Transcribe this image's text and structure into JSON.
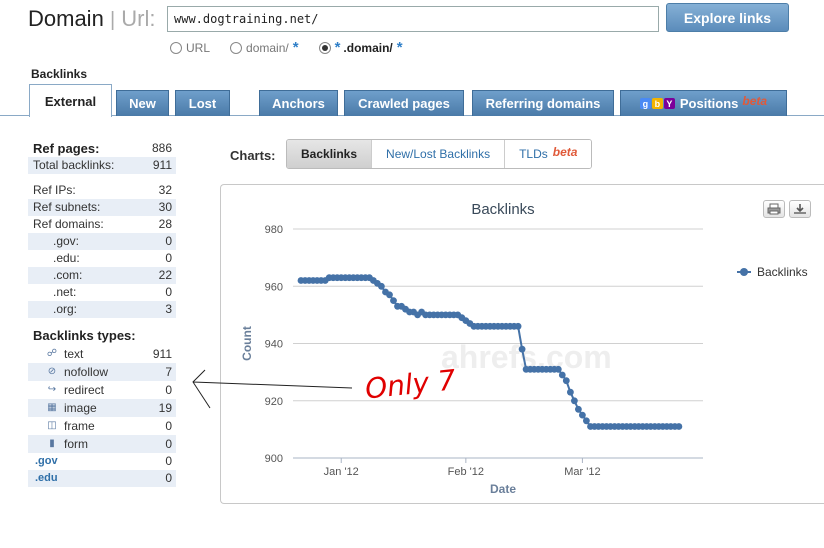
{
  "header": {
    "brand_domain": "Domain",
    "brand_sep": "|",
    "brand_url": "Url:",
    "url_value": "www.dogtraining.net/",
    "explore_label": "Explore links",
    "radio_url": "URL",
    "radio_domain": "domain/",
    "radio_star": "*",
    "radio_subdomain": ".domain/",
    "radio_subdomain_prefix": "*"
  },
  "section_title": "Backlinks",
  "tabs": {
    "external": "External",
    "new": "New",
    "lost": "Lost",
    "anchors": "Anchors",
    "crawled": "Crawled pages",
    "referring": "Referring domains",
    "positions": "Positions",
    "beta": "beta"
  },
  "stats": {
    "ref_pages": {
      "k": "Ref pages:",
      "v": "886"
    },
    "total_backlinks": {
      "k": "Total backlinks:",
      "v": "911"
    },
    "ref_ips": {
      "k": "Ref IPs:",
      "v": "32"
    },
    "ref_subnets": {
      "k": "Ref subnets:",
      "v": "30"
    },
    "ref_domains": {
      "k": "Ref domains:",
      "v": "28"
    },
    "gov": {
      "k": ".gov:",
      "v": "0"
    },
    "edu": {
      "k": ".edu:",
      "v": "0"
    },
    "com": {
      "k": ".com:",
      "v": "22"
    },
    "net": {
      "k": ".net:",
      "v": "0"
    },
    "org": {
      "k": ".org:",
      "v": "3"
    },
    "types_head": "Backlinks types:",
    "text": {
      "k": "text",
      "v": "911"
    },
    "nofollow": {
      "k": "nofollow",
      "v": "7"
    },
    "redirect": {
      "k": "redirect",
      "v": "0"
    },
    "image": {
      "k": "image",
      "v": "19"
    },
    "frame": {
      "k": "frame",
      "v": "0"
    },
    "form": {
      "k": "form",
      "v": "0"
    },
    "gov_link": {
      "k": ".gov",
      "v": "0"
    },
    "edu_link": {
      "k": ".edu",
      "v": "0"
    }
  },
  "charts": {
    "label": "Charts:",
    "tab_backlinks": "Backlinks",
    "tab_newlost": "New/Lost Backlinks",
    "tab_tlds": "TLDs",
    "beta": "beta"
  },
  "annotation": "Only 7",
  "colors": {
    "series": "#4572a7",
    "tab": "#5a8ab8",
    "beta": "#e05a3a",
    "annotation": "#e00000"
  },
  "chart_data": {
    "type": "line",
    "title": "Backlinks",
    "xlabel": "Date",
    "ylabel": "Count",
    "ylim": [
      900,
      980
    ],
    "yticks": [
      900,
      920,
      940,
      960,
      980
    ],
    "xticks": [
      {
        "date": "2012-01-01",
        "label": "Jan '12"
      },
      {
        "date": "2012-02-01",
        "label": "Feb '12"
      },
      {
        "date": "2012-03-01",
        "label": "Mar '12"
      }
    ],
    "xlim": [
      "2011-12-20",
      "2012-03-31"
    ],
    "legend": "right",
    "series": [
      {
        "name": "Backlinks",
        "points": [
          [
            "2011-12-22",
            962
          ],
          [
            "2011-12-23",
            962
          ],
          [
            "2011-12-24",
            962
          ],
          [
            "2011-12-25",
            962
          ],
          [
            "2011-12-26",
            962
          ],
          [
            "2011-12-27",
            962
          ],
          [
            "2011-12-28",
            962
          ],
          [
            "2011-12-29",
            963
          ],
          [
            "2011-12-30",
            963
          ],
          [
            "2011-12-31",
            963
          ],
          [
            "2012-01-01",
            963
          ],
          [
            "2012-01-02",
            963
          ],
          [
            "2012-01-03",
            963
          ],
          [
            "2012-01-04",
            963
          ],
          [
            "2012-01-05",
            963
          ],
          [
            "2012-01-06",
            963
          ],
          [
            "2012-01-07",
            963
          ],
          [
            "2012-01-08",
            963
          ],
          [
            "2012-01-09",
            962
          ],
          [
            "2012-01-10",
            961
          ],
          [
            "2012-01-11",
            960
          ],
          [
            "2012-01-12",
            958
          ],
          [
            "2012-01-13",
            957
          ],
          [
            "2012-01-14",
            955
          ],
          [
            "2012-01-15",
            953
          ],
          [
            "2012-01-16",
            953
          ],
          [
            "2012-01-17",
            952
          ],
          [
            "2012-01-18",
            951
          ],
          [
            "2012-01-19",
            951
          ],
          [
            "2012-01-20",
            950
          ],
          [
            "2012-01-21",
            951
          ],
          [
            "2012-01-22",
            950
          ],
          [
            "2012-01-23",
            950
          ],
          [
            "2012-01-24",
            950
          ],
          [
            "2012-01-25",
            950
          ],
          [
            "2012-01-26",
            950
          ],
          [
            "2012-01-27",
            950
          ],
          [
            "2012-01-28",
            950
          ],
          [
            "2012-01-29",
            950
          ],
          [
            "2012-01-30",
            950
          ],
          [
            "2012-01-31",
            949
          ],
          [
            "2012-02-01",
            948
          ],
          [
            "2012-02-02",
            947
          ],
          [
            "2012-02-03",
            946
          ],
          [
            "2012-02-04",
            946
          ],
          [
            "2012-02-05",
            946
          ],
          [
            "2012-02-06",
            946
          ],
          [
            "2012-02-07",
            946
          ],
          [
            "2012-02-08",
            946
          ],
          [
            "2012-02-09",
            946
          ],
          [
            "2012-02-10",
            946
          ],
          [
            "2012-02-11",
            946
          ],
          [
            "2012-02-12",
            946
          ],
          [
            "2012-02-13",
            946
          ],
          [
            "2012-02-14",
            946
          ],
          [
            "2012-02-15",
            938
          ],
          [
            "2012-02-16",
            931
          ],
          [
            "2012-02-17",
            931
          ],
          [
            "2012-02-18",
            931
          ],
          [
            "2012-02-19",
            931
          ],
          [
            "2012-02-20",
            931
          ],
          [
            "2012-02-21",
            931
          ],
          [
            "2012-02-22",
            931
          ],
          [
            "2012-02-23",
            931
          ],
          [
            "2012-02-24",
            931
          ],
          [
            "2012-02-25",
            929
          ],
          [
            "2012-02-26",
            927
          ],
          [
            "2012-02-27",
            923
          ],
          [
            "2012-02-28",
            920
          ],
          [
            "2012-02-29",
            917
          ],
          [
            "2012-03-01",
            915
          ],
          [
            "2012-03-02",
            913
          ],
          [
            "2012-03-03",
            911
          ],
          [
            "2012-03-04",
            911
          ],
          [
            "2012-03-05",
            911
          ],
          [
            "2012-03-06",
            911
          ],
          [
            "2012-03-07",
            911
          ],
          [
            "2012-03-08",
            911
          ],
          [
            "2012-03-09",
            911
          ],
          [
            "2012-03-10",
            911
          ],
          [
            "2012-03-11",
            911
          ],
          [
            "2012-03-12",
            911
          ],
          [
            "2012-03-13",
            911
          ],
          [
            "2012-03-14",
            911
          ],
          [
            "2012-03-15",
            911
          ],
          [
            "2012-03-16",
            911
          ],
          [
            "2012-03-17",
            911
          ],
          [
            "2012-03-18",
            911
          ],
          [
            "2012-03-19",
            911
          ],
          [
            "2012-03-20",
            911
          ],
          [
            "2012-03-21",
            911
          ],
          [
            "2012-03-22",
            911
          ],
          [
            "2012-03-23",
            911
          ],
          [
            "2012-03-24",
            911
          ],
          [
            "2012-03-25",
            911
          ]
        ]
      }
    ]
  }
}
